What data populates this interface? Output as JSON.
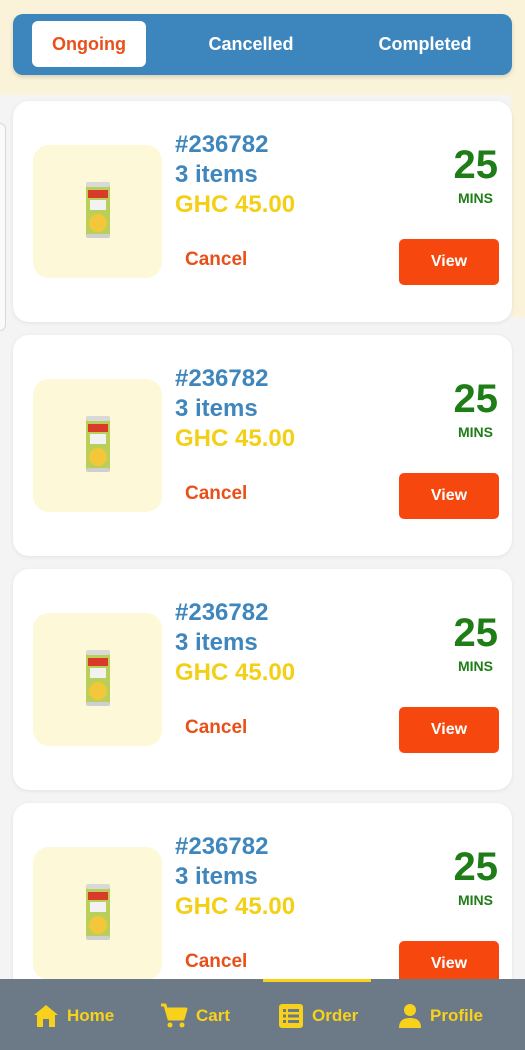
{
  "tabs": [
    {
      "label": "Ongoing",
      "active": true
    },
    {
      "label": "Cancelled",
      "active": false
    },
    {
      "label": "Completed",
      "active": false
    }
  ],
  "orders": [
    {
      "id": "#236782",
      "items": "3 items",
      "price": "GHC 45.00",
      "time": "25",
      "time_unit": "MINS",
      "cancel_label": "Cancel",
      "view_label": "View"
    },
    {
      "id": "#236782",
      "items": "3 items",
      "price": "GHC 45.00",
      "time": "25",
      "time_unit": "MINS",
      "cancel_label": "Cancel",
      "view_label": "View"
    },
    {
      "id": "#236782",
      "items": "3 items",
      "price": "GHC 45.00",
      "time": "25",
      "time_unit": "MINS",
      "cancel_label": "Cancel",
      "view_label": "View"
    },
    {
      "id": "#236782",
      "items": "3 items",
      "price": "GHC 45.00",
      "time": "25",
      "time_unit": "MINS",
      "cancel_label": "Cancel",
      "view_label": "View"
    }
  ],
  "nav": {
    "items": [
      {
        "label": "Home",
        "icon": "home-icon"
      },
      {
        "label": "Cart",
        "icon": "cart-icon"
      },
      {
        "label": "Order",
        "icon": "order-list-icon",
        "active": true
      },
      {
        "label": "Profile",
        "icon": "profile-icon"
      }
    ]
  },
  "colors": {
    "tab_bar": "#3d86bd",
    "accent_orange": "#f5470e",
    "time_green": "#1e7d16",
    "price_yellow": "#f3cf16",
    "id_blue": "#3f86bd",
    "nav_bg": "#6b7a86",
    "nav_fg": "#f8d21a"
  }
}
